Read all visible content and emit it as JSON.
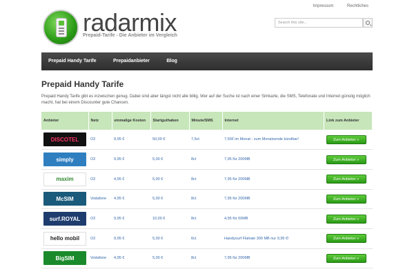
{
  "toplinks": [
    "Impressum",
    "Rechtliches"
  ],
  "logo": {
    "name": "radarmix",
    "tagline": "Prepaid-Tarife - Die Anbieter im Vergleich"
  },
  "search": {
    "placeholder": "Search this site..."
  },
  "nav": [
    "Prepaid Handy Tarife",
    "Prepaidanbieter",
    "Blog"
  ],
  "page": {
    "title": "Prepaid Handy Tarife",
    "intro": "Prepaid Handy Tarife gibt es inzwischen genug. Dabei sind aber längst nicht alle billig. Wer auf der Suche ist nach einer Simkarte, die SMS, Telefonate und Internet günstig möglich macht, hat bei einem Discounter gute Chancen."
  },
  "table": {
    "headers": [
      "Anbieter",
      "Netz",
      "einmalige Kosten",
      "Startguthaben",
      "Minute/SMS",
      "Internet",
      "Link zum Anbieter"
    ],
    "button_label": "Zum Anbieter »",
    "rows": [
      {
        "logo": "DISCOTEL",
        "logo_bg": "#111111",
        "logo_fg": "#ff3366",
        "netz": "O2",
        "kosten": "9,95 €",
        "start": "50,00 €",
        "min": "7,5ct",
        "internet": "7,50€ im Monat - zum Monatsende kündbar!"
      },
      {
        "logo": "simply",
        "logo_bg": "#2f7fc0",
        "logo_fg": "#ffffff",
        "netz": "O2",
        "kosten": "9,95 €",
        "start": "5,00 €",
        "min": "8ct",
        "internet": "7,95 für 200MB"
      },
      {
        "logo": "maxim",
        "logo_bg": "#ffffff",
        "logo_fg": "#338833",
        "netz": "O2",
        "kosten": "4,95 €",
        "start": "5,00 €",
        "min": "8ct",
        "internet": "7,95 für 200MB"
      },
      {
        "logo": "McSIM",
        "logo_bg": "#1a5a7a",
        "logo_fg": "#ffffff",
        "netz": "Vodafone",
        "kosten": "4,95 €",
        "start": "5,00 €",
        "min": "8ct",
        "internet": "7,95 für 200MB"
      },
      {
        "logo": "surf.ROYAL",
        "logo_bg": "#1e3c6e",
        "logo_fg": "#ffffff",
        "netz": "O2",
        "kosten": "9,95 €",
        "start": "10,00 €",
        "min": "8ct",
        "internet": "4,95 für 50MB"
      },
      {
        "logo": "hello mobil",
        "logo_bg": "#ffffff",
        "logo_fg": "#222222",
        "netz": "O2",
        "kosten": "9,95 €",
        "start": "5,00 €",
        "min": "6ct",
        "internet": "Handysurf Flatrate 300 MB nur 9,95 €!"
      },
      {
        "logo": "BigSIM",
        "logo_bg": "#1a8a2a",
        "logo_fg": "#ffffff",
        "netz": "Vodafone",
        "kosten": "4,95 €",
        "start": "5,00 €",
        "min": "8ct",
        "internet": "7,95 für 200MB"
      }
    ]
  }
}
